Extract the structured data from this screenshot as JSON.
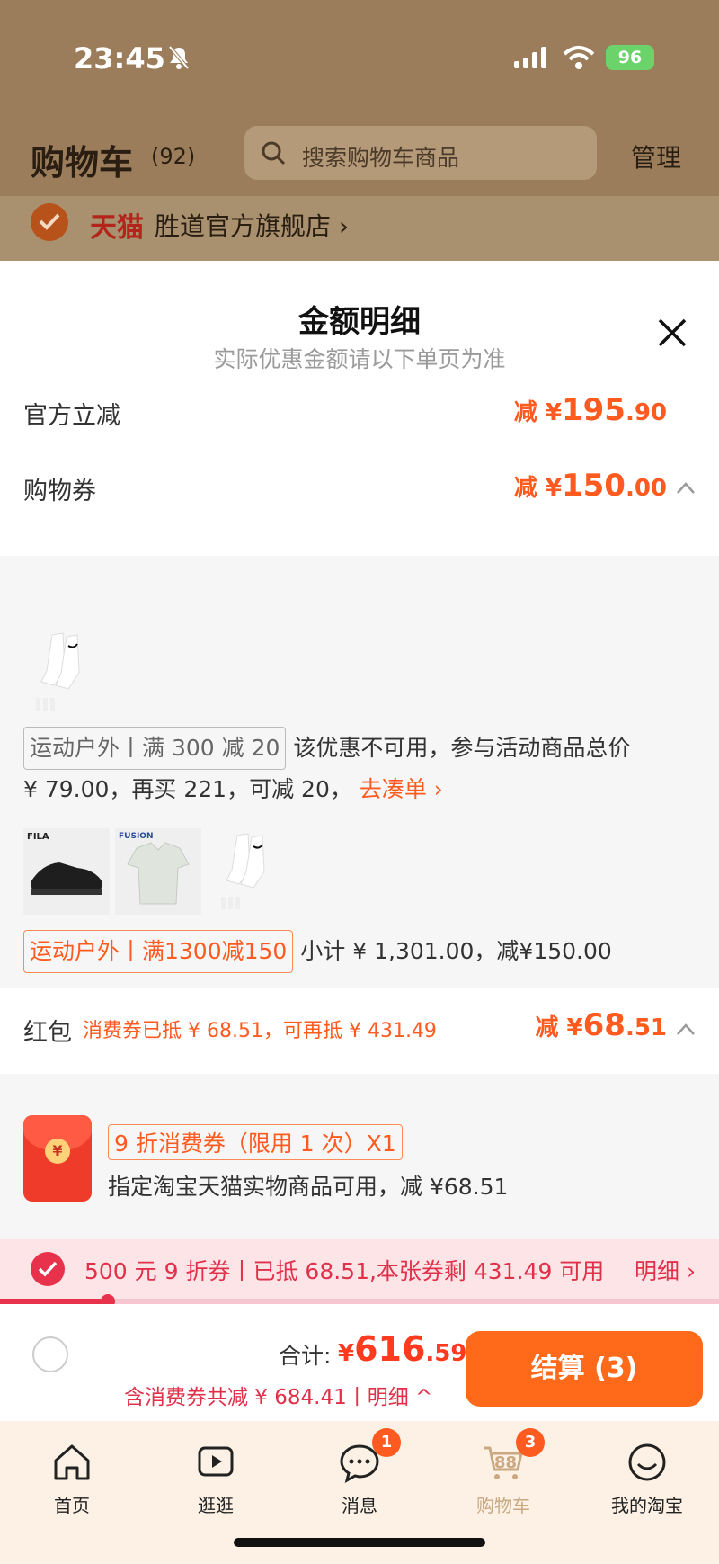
{
  "status": {
    "time": "23:45",
    "battery": "96"
  },
  "header": {
    "title": "购物车",
    "count": "(92)",
    "search_placeholder": "搜索购物车商品",
    "manage": "管理"
  },
  "store": {
    "brand": "天猫",
    "name": "胜道官方旗舰店",
    "chevron": "›"
  },
  "sheet": {
    "title": "金额明细",
    "subtitle": "实际优惠金额请以下单页为准",
    "official": {
      "label": "官方立减",
      "prefix": "减 ¥",
      "int": "195",
      "dec": ".90"
    },
    "coupon": {
      "label": "购物券",
      "prefix": "减 ¥",
      "int": "150",
      "dec": ".00"
    },
    "coupon_panel": {
      "tag1": "运动户外丨满 300 减 20",
      "text1": "该优惠不可用，参与活动商品总价",
      "text2": "¥ 79.00，再买 221，可减 20，",
      "link": "去凑单 ›",
      "tag2": "运动户外丨满1300减150",
      "text3": "小计 ¥ 1,301.00，减¥150.00",
      "brand1": "FILA",
      "brand2": "FUSION"
    },
    "hongbao": {
      "label": "红包",
      "sub": "消费券已抵 ¥ 68.51，可再抵 ¥ 431.49",
      "prefix": "减 ¥",
      "int": "68",
      "dec": ".51"
    },
    "hb_panel": {
      "tag": "9 折消费券（限用 1 次）X1",
      "desc": "指定淘宝天猫实物商品可用，减 ¥68.51",
      "seal": "¥"
    }
  },
  "promo": {
    "text": "500 元 9 折券丨已抵 68.51,本张券剩 431.49 可用",
    "link": "明细 ›",
    "progress": 0.15
  },
  "checkout": {
    "total_label": "合计:",
    "currency": "¥",
    "int": "616",
    "dec": ".59",
    "saved": "含消费券共减 ¥ 684.41丨明细 ^",
    "button": "结算 (3)"
  },
  "tabs": [
    {
      "label": "首页",
      "icon": "home-icon"
    },
    {
      "label": "逛逛",
      "icon": "play-icon"
    },
    {
      "label": "消息",
      "icon": "message-icon",
      "badge": "1"
    },
    {
      "label": "购物车",
      "icon": "cart-icon",
      "badge": "3",
      "cart_num": "88"
    },
    {
      "label": "我的淘宝",
      "icon": "profile-icon"
    }
  ],
  "colors": {
    "accent": "#ff5a1f",
    "red": "#e8324b",
    "header_bg": "#9c7d5b"
  }
}
